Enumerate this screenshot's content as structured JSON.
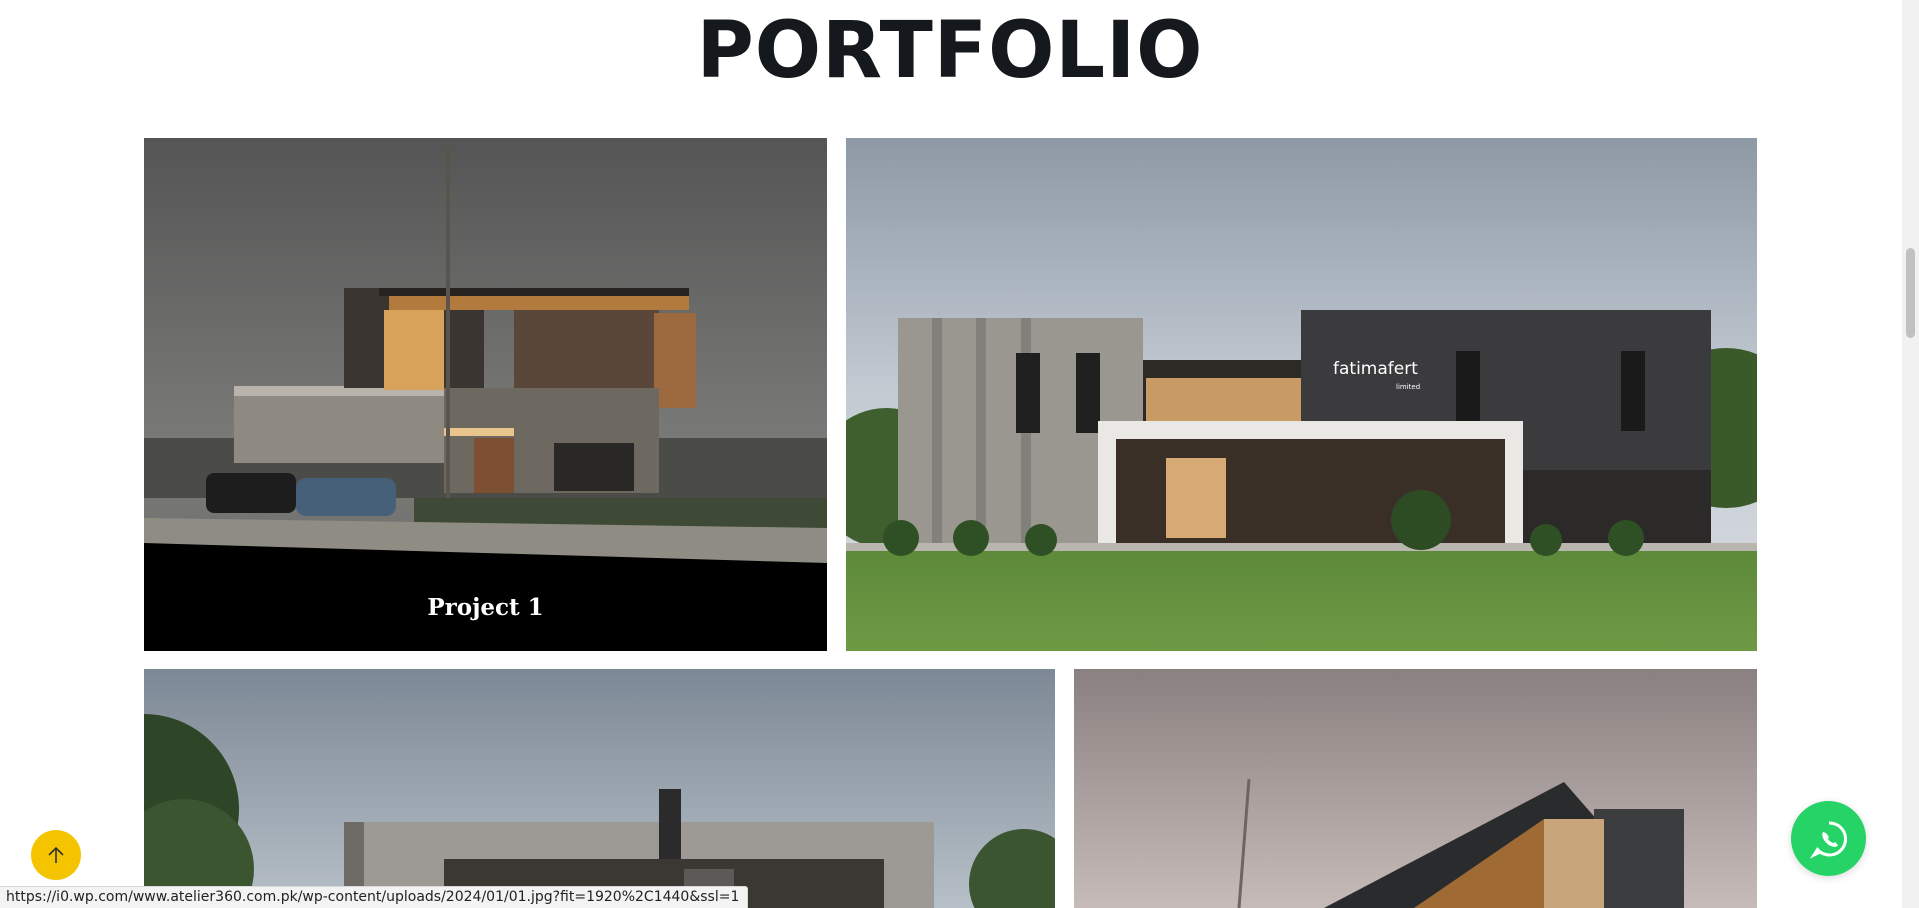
{
  "page": {
    "title": "PORTFOLIO"
  },
  "portfolio": {
    "items": [
      {
        "caption": "Project 1"
      },
      {
        "sign_text": "fatimafert",
        "sign_subtext": "limited"
      },
      {},
      {}
    ]
  },
  "status_bar": {
    "url": "https://i0.wp.com/www.atelier360.com.pk/wp-content/uploads/2024/01/01.jpg?fit=1920%2C1440&ssl=1"
  },
  "icons": {
    "back_to_top": "arrow-up-icon",
    "whatsapp": "whatsapp-icon"
  },
  "colors": {
    "accent_yellow": "#f5c400",
    "whatsapp_green": "#25d366",
    "title": "#15181c"
  }
}
